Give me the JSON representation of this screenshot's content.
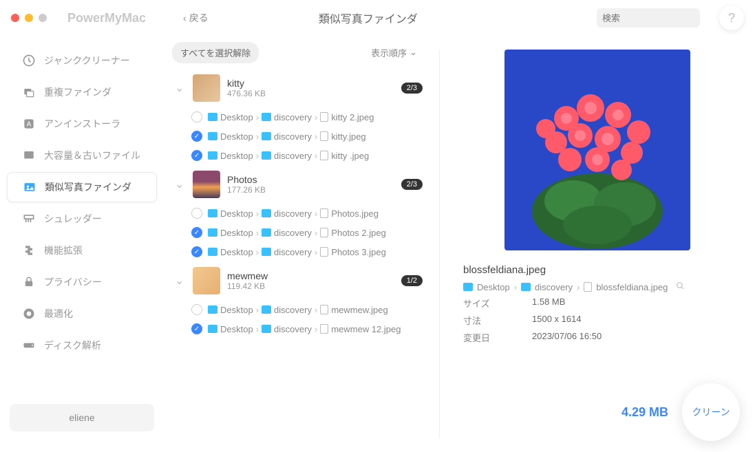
{
  "app_name": "PowerMyMac",
  "back_label": "戻る",
  "page_title": "類似写真ファインダ",
  "search_placeholder": "検索",
  "help_label": "?",
  "sidebar": {
    "items": [
      {
        "icon": "junk",
        "label": "ジャンククリーナー"
      },
      {
        "icon": "duplicate",
        "label": "重複ファインダ"
      },
      {
        "icon": "uninstaller",
        "label": "アンインストーラ"
      },
      {
        "icon": "largefiles",
        "label": "大容量＆古いファイル"
      },
      {
        "icon": "similar",
        "label": "類似写真ファインダ",
        "active": true
      },
      {
        "icon": "shredder",
        "label": "シュレッダー"
      },
      {
        "icon": "extensions",
        "label": "機能拡張"
      },
      {
        "icon": "privacy",
        "label": "プライバシー"
      },
      {
        "icon": "optimize",
        "label": "最適化"
      },
      {
        "icon": "disk",
        "label": "ディスク解析"
      }
    ],
    "user": "eliene"
  },
  "list": {
    "deselect_all": "すべてを選択解除",
    "sort_label": "表示順序",
    "groups": [
      {
        "name": "kitty",
        "size": "476.36 KB",
        "badge": "2/3",
        "thumb_class": "thumb-kitty",
        "files": [
          {
            "checked": false,
            "path": [
              "Desktop",
              "discovery"
            ],
            "name": "kitty 2.jpeg"
          },
          {
            "checked": true,
            "path": [
              "Desktop",
              "discovery"
            ],
            "name": "kitty.jpeg"
          },
          {
            "checked": true,
            "path": [
              "Desktop",
              "discovery"
            ],
            "name": "kitty .jpeg"
          }
        ]
      },
      {
        "name": "Photos",
        "size": "177.26 KB",
        "badge": "2/3",
        "thumb_class": "thumb-photos",
        "files": [
          {
            "checked": false,
            "path": [
              "Desktop",
              "discovery"
            ],
            "name": "Photos.jpeg"
          },
          {
            "checked": true,
            "path": [
              "Desktop",
              "discovery"
            ],
            "name": "Photos 2.jpeg"
          },
          {
            "checked": true,
            "path": [
              "Desktop",
              "discovery"
            ],
            "name": "Photos 3.jpeg"
          }
        ]
      },
      {
        "name": "mewmew",
        "size": "119.42 KB",
        "badge": "1/2",
        "thumb_class": "thumb-mewmew",
        "files": [
          {
            "checked": false,
            "path": [
              "Desktop",
              "discovery"
            ],
            "name": "mewmew.jpeg"
          },
          {
            "checked": true,
            "path": [
              "Desktop",
              "discovery"
            ],
            "name": "mewmew 12.jpeg"
          }
        ]
      }
    ]
  },
  "preview": {
    "filename": "blossfeldiana.jpeg",
    "path": [
      "Desktop",
      "discovery",
      "blossfeldiana.jpeg"
    ],
    "meta": {
      "size_label": "サイズ",
      "size_val": "1.58 MB",
      "dim_label": "寸法",
      "dim_val": "1500 x 1614",
      "mod_label": "変更日",
      "mod_val": "2023/07/06 16:50"
    }
  },
  "footer": {
    "total": "4.29 MB",
    "clean": "クリーン"
  }
}
